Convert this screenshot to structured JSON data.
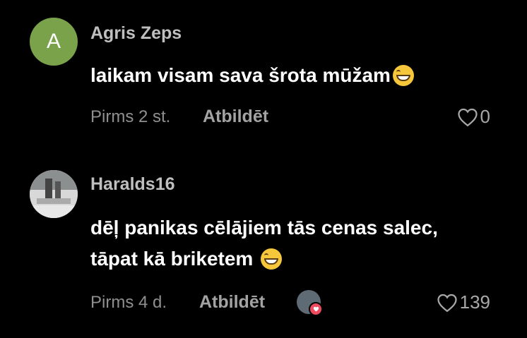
{
  "comments": [
    {
      "avatar_letter": "A",
      "avatar_color": "#7aa24a",
      "username": "Agris Zeps",
      "text_lines": [
        "laikam visam sava šrota mūžam"
      ],
      "emoji": "grinning-face",
      "time": "Pirms 2 st.",
      "reply_label": "Atbildēt",
      "likes": "0",
      "creator_liked": false
    },
    {
      "avatar_letter": "",
      "username": "Haralds16",
      "text_lines": [
        "dēļ panikas cēlājiem tās cenas salec,",
        "tāpat kā briketem"
      ],
      "emoji": "grinning-face",
      "time": "Pirms 4 d.",
      "reply_label": "Atbildēt",
      "likes": "139",
      "creator_liked": true
    }
  ]
}
